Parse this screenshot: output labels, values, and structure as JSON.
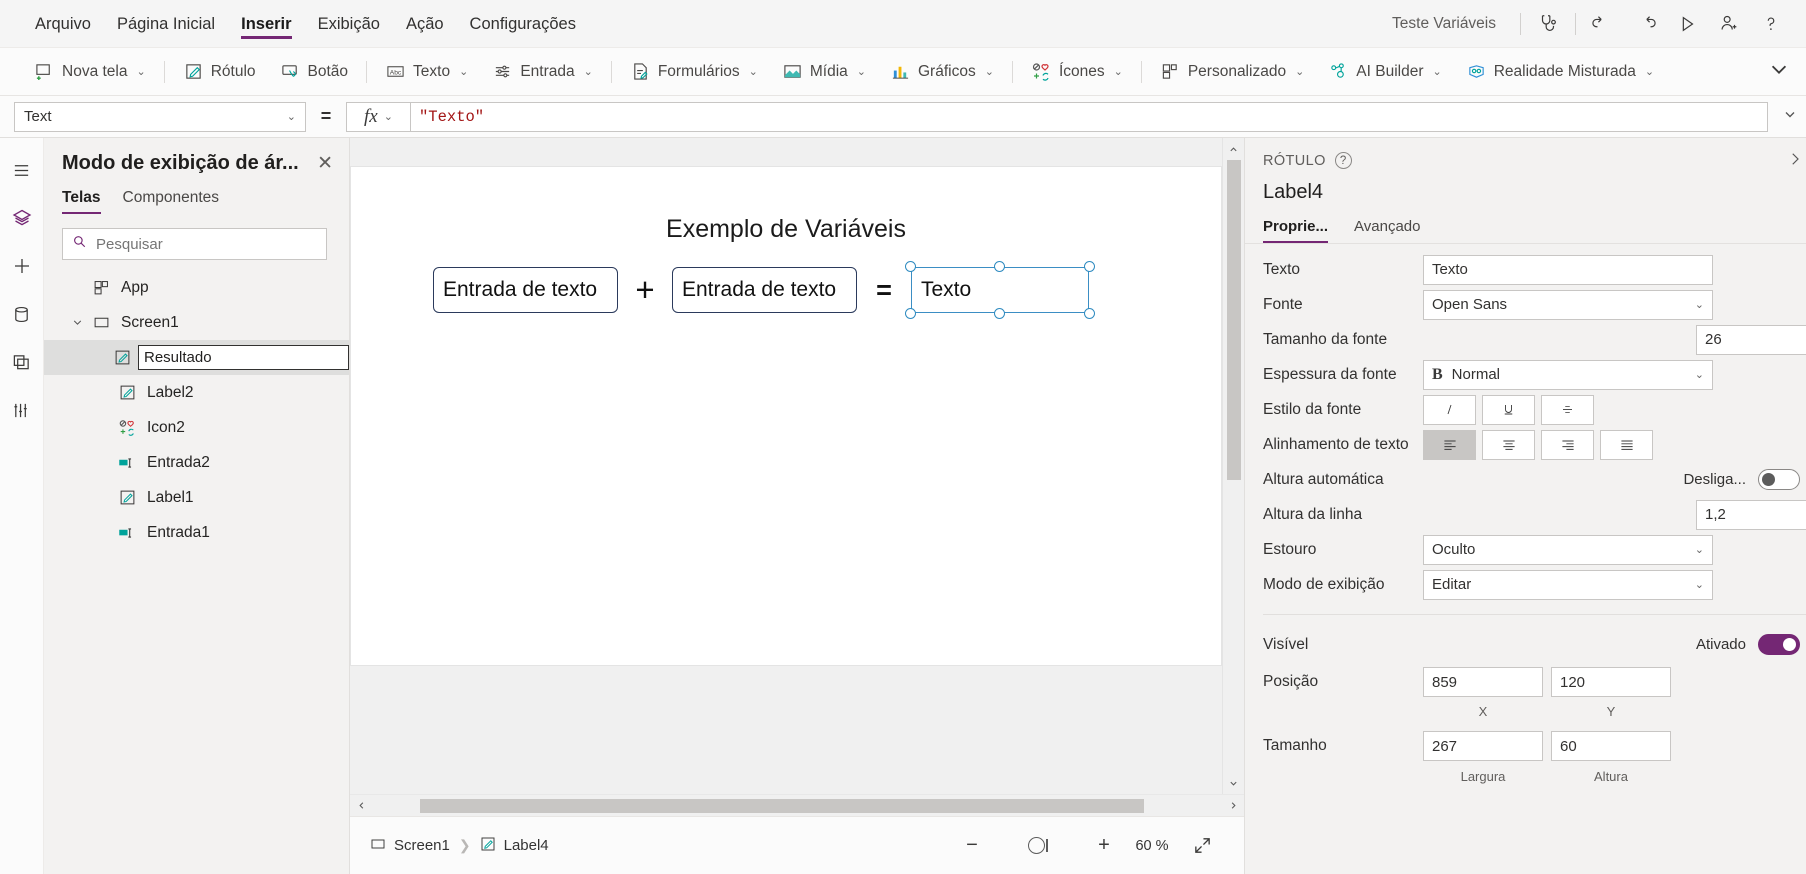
{
  "menu": {
    "items": [
      "Arquivo",
      "Página Inicial",
      "Inserir",
      "Exibição",
      "Ação",
      "Configurações"
    ],
    "active_index": 2,
    "app_title": "Teste Variáveis",
    "right_icons": [
      "stethoscope-icon",
      "undo-icon",
      "redo-icon",
      "play-icon",
      "share-user-icon",
      "help-icon"
    ]
  },
  "toolbar": {
    "items": [
      {
        "label": "Nova tela",
        "icon": "new-screen-icon",
        "caret": true
      },
      {
        "label": "Rótulo",
        "icon": "label-icon",
        "caret": false
      },
      {
        "label": "Botão",
        "icon": "button-icon",
        "caret": false
      },
      {
        "label": "Texto",
        "icon": "text-abc-icon",
        "caret": true
      },
      {
        "label": "Entrada",
        "icon": "input-sliders-icon",
        "caret": true
      },
      {
        "label": "Formulários",
        "icon": "forms-icon",
        "caret": true
      },
      {
        "label": "Mídia",
        "icon": "media-image-icon",
        "caret": true
      },
      {
        "label": "Gráficos",
        "icon": "charts-bar-icon",
        "caret": true
      },
      {
        "label": "Ícones",
        "icon": "icons-shapes-icon",
        "caret": true
      },
      {
        "label": "Personalizado",
        "icon": "custom-blocks-icon",
        "caret": true
      },
      {
        "label": "AI Builder",
        "icon": "ai-builder-icon",
        "caret": true
      },
      {
        "label": "Realidade Misturada",
        "icon": "mixed-reality-icon",
        "caret": true
      }
    ],
    "overflow": "chevron-down-icon"
  },
  "formula_bar": {
    "property": "Text",
    "equals": "=",
    "fx": "fx",
    "formula": "\"Texto\""
  },
  "tree": {
    "title": "Modo de exibição de ár...",
    "close_label": "✕",
    "tabs": [
      "Telas",
      "Componentes"
    ],
    "active_tab": 0,
    "search_placeholder": "Pesquisar",
    "items": [
      {
        "label": "App",
        "icon": "app-icon",
        "level": 0,
        "twisty": "",
        "selected": false,
        "editing": false
      },
      {
        "label": "Screen1",
        "icon": "screen-icon",
        "level": 1,
        "twisty": "expanded",
        "selected": false,
        "editing": false
      },
      {
        "label": "Resultado",
        "icon": "label-pencil-icon",
        "level": 2,
        "twisty": "",
        "selected": true,
        "editing": true
      },
      {
        "label": "Label2",
        "icon": "label-pencil-icon",
        "level": 2,
        "twisty": "",
        "selected": false,
        "editing": false
      },
      {
        "label": "Icon2",
        "icon": "icons-shapes-icon",
        "level": 2,
        "twisty": "",
        "selected": false,
        "editing": false
      },
      {
        "label": "Entrada2",
        "icon": "text-input-icon",
        "level": 2,
        "twisty": "",
        "selected": false,
        "editing": false
      },
      {
        "label": "Label1",
        "icon": "label-pencil-icon",
        "level": 2,
        "twisty": "",
        "selected": false,
        "editing": false
      },
      {
        "label": "Entrada1",
        "icon": "text-input-icon",
        "level": 2,
        "twisty": "",
        "selected": false,
        "editing": false
      }
    ]
  },
  "canvas": {
    "screen_title": "Exemplo de Variáveis",
    "input1": "Entrada de texto",
    "plus": "+",
    "input2": "Entrada de texto",
    "equals": "=",
    "result_label": "Texto"
  },
  "statusbar": {
    "breadcrumb": [
      {
        "label": "Screen1",
        "icon": "screen-icon"
      },
      {
        "label": "Label4",
        "icon": "label-pencil-icon"
      }
    ],
    "zoom_out": "−",
    "zoom_in": "+",
    "zoom_value": "60",
    "zoom_unit": "%",
    "fullscreen_icon": "fullscreen-icon"
  },
  "properties": {
    "kicker": "RÓTULO",
    "control_name": "Label4",
    "tabs": [
      "Proprie...",
      "Avançado"
    ],
    "active_tab": 0,
    "rows": [
      {
        "label": "Texto",
        "type": "input",
        "value": "Texto",
        "name": "text-property"
      },
      {
        "label": "Fonte",
        "type": "select",
        "value": "Open Sans",
        "name": "font-property"
      },
      {
        "label": "Tamanho da fonte",
        "type": "number",
        "value": "26",
        "name": "font-size-property"
      },
      {
        "label": "Espessura da fonte",
        "type": "select-bold",
        "value": "Normal",
        "name": "font-weight-property"
      },
      {
        "label": "Estilo da fonte",
        "type": "segments-style",
        "value": "",
        "name": "font-style-property"
      },
      {
        "label": "Alinhamento de texto",
        "type": "segments-align",
        "value": "",
        "name": "text-align-property"
      },
      {
        "label": "Altura automática",
        "type": "toggle-off",
        "value": "Desliga...",
        "name": "auto-height-property"
      },
      {
        "label": "Altura da linha",
        "type": "number",
        "value": "1,2",
        "name": "line-height-property"
      },
      {
        "label": "Estouro",
        "type": "select",
        "value": "Oculto",
        "name": "overflow-property"
      },
      {
        "label": "Modo de exibição",
        "type": "select",
        "value": "Editar",
        "name": "display-mode-property"
      }
    ],
    "visible": {
      "label": "Visível",
      "state": "Ativado"
    },
    "position": {
      "label": "Posição",
      "x": "859",
      "y": "120",
      "x_sub": "X",
      "y_sub": "Y"
    },
    "size": {
      "label": "Tamanho",
      "w": "267",
      "h": "60",
      "w_sub": "Largura",
      "h_sub": "Altura"
    }
  },
  "rail": {
    "items": [
      "hamburger-icon",
      "layers-icon",
      "plus-insert-icon",
      "data-cylinder-icon",
      "media-rail-icon",
      "variables-icon"
    ]
  },
  "colors": {
    "accent": "#742774",
    "formula": "#a31515",
    "selection": "#2e8bc0",
    "canvas_border": "#2b3a5c"
  }
}
